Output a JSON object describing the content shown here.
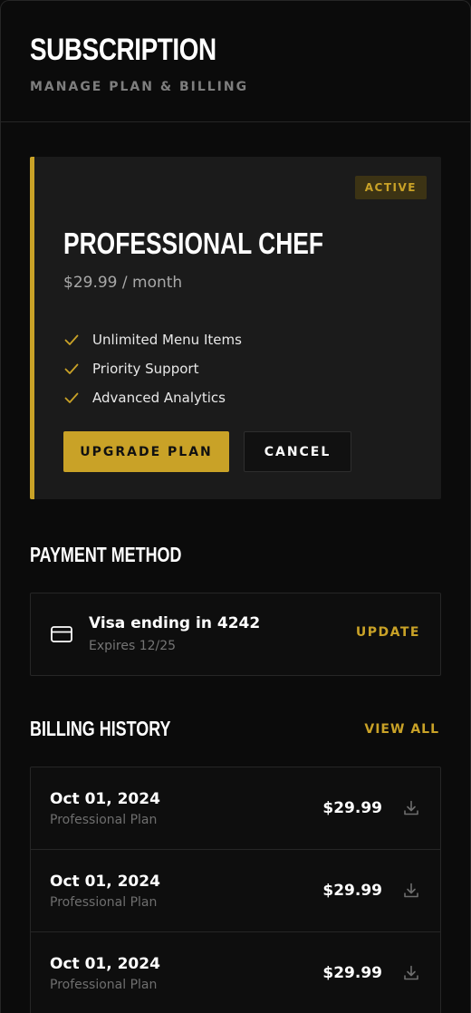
{
  "header": {
    "title": "SUBSCRIPTION",
    "subtitle": "MANAGE PLAN & BILLING"
  },
  "plan": {
    "status": "ACTIVE",
    "name": "PROFESSIONAL CHEF",
    "price": "$29.99 / month",
    "features": [
      "Unlimited Menu Items",
      "Priority Support",
      "Advanced Analytics"
    ],
    "feature_icon": "check-icon",
    "upgrade_label": "UPGRADE PLAN",
    "cancel_label": "CANCEL"
  },
  "payment": {
    "title": "PAYMENT METHOD",
    "card_icon": "credit-card-icon",
    "card_name": "Visa ending in 4242",
    "expires": "Expires 12/25",
    "update_label": "UPDATE"
  },
  "billing": {
    "title": "BILLING HISTORY",
    "view_all_label": "VIEW ALL",
    "download_icon": "download-icon",
    "rows": [
      {
        "date": "Oct 01, 2024",
        "plan": "Professional Plan",
        "amount": "$29.99"
      },
      {
        "date": "Oct 01, 2024",
        "plan": "Professional Plan",
        "amount": "$29.99"
      },
      {
        "date": "Oct 01, 2024",
        "plan": "Professional Plan",
        "amount": "$29.99"
      }
    ]
  },
  "colors": {
    "background": "#0b0b0b",
    "card": "#1b1b1b",
    "accent": "#c9a227",
    "border": "#262626",
    "muted_text": "#7e7e7e"
  }
}
